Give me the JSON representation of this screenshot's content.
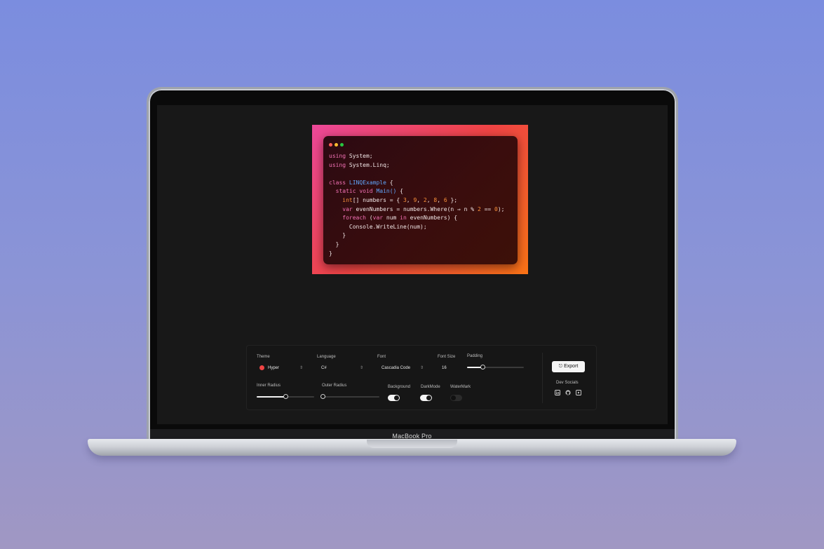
{
  "device": {
    "label": "MacBook Pro"
  },
  "code_window": {
    "lines": [
      [
        {
          "t": "using",
          "c": "kw"
        },
        {
          "t": " System;",
          "c": ""
        }
      ],
      [
        {
          "t": "using",
          "c": "kw"
        },
        {
          "t": " System.Linq;",
          "c": ""
        }
      ],
      [],
      [
        {
          "t": "class",
          "c": "kw"
        },
        {
          "t": " ",
          "c": ""
        },
        {
          "t": "LINQExample",
          "c": "ty"
        },
        {
          "t": " {",
          "c": ""
        }
      ],
      [
        {
          "t": "  ",
          "c": ""
        },
        {
          "t": "static void",
          "c": "kw"
        },
        {
          "t": " ",
          "c": ""
        },
        {
          "t": "Main()",
          "c": "ty"
        },
        {
          "t": " {",
          "c": ""
        }
      ],
      [
        {
          "t": "    ",
          "c": ""
        },
        {
          "t": "int",
          "c": "num"
        },
        {
          "t": "[] numbers = { ",
          "c": ""
        },
        {
          "t": "3",
          "c": "num"
        },
        {
          "t": ", ",
          "c": ""
        },
        {
          "t": "9",
          "c": "num"
        },
        {
          "t": ", ",
          "c": ""
        },
        {
          "t": "2",
          "c": "num"
        },
        {
          "t": ", ",
          "c": ""
        },
        {
          "t": "8",
          "c": "num"
        },
        {
          "t": ", ",
          "c": ""
        },
        {
          "t": "6",
          "c": "num"
        },
        {
          "t": " };",
          "c": ""
        }
      ],
      [
        {
          "t": "    ",
          "c": ""
        },
        {
          "t": "var",
          "c": "kw"
        },
        {
          "t": " evenNumbers = numbers.Where(n ⇒ n % ",
          "c": ""
        },
        {
          "t": "2",
          "c": "num"
        },
        {
          "t": " == ",
          "c": ""
        },
        {
          "t": "0",
          "c": "num"
        },
        {
          "t": ");",
          "c": ""
        }
      ],
      [
        {
          "t": "    ",
          "c": ""
        },
        {
          "t": "foreach",
          "c": "kw"
        },
        {
          "t": " (",
          "c": ""
        },
        {
          "t": "var",
          "c": "kw"
        },
        {
          "t": " num ",
          "c": ""
        },
        {
          "t": "in",
          "c": "kw"
        },
        {
          "t": " evenNumbers) {",
          "c": ""
        }
      ],
      [
        {
          "t": "      Console.WriteLine(num);",
          "c": ""
        }
      ],
      [
        {
          "t": "    }",
          "c": ""
        }
      ],
      [
        {
          "t": "  }",
          "c": ""
        }
      ],
      [
        {
          "t": "}",
          "c": ""
        }
      ]
    ]
  },
  "controls": {
    "theme": {
      "label": "Theme",
      "value": "Hyper"
    },
    "language": {
      "label": "Language",
      "value": "C#"
    },
    "font": {
      "label": "Font",
      "value": "Cascadia Code"
    },
    "font_size": {
      "label": "Font Size",
      "value": "16"
    },
    "padding": {
      "label": "Padding",
      "level": 0.27
    },
    "inner_radius": {
      "label": "Inner Radius",
      "level": 0.5
    },
    "outer_radius": {
      "label": "Outer Radius",
      "level": 0.0
    },
    "background": {
      "label": "Background",
      "on": true
    },
    "darkmode": {
      "label": "DarkMode",
      "on": true
    },
    "watermark": {
      "label": "WaterMark",
      "on": false
    },
    "export_label": "Export",
    "dev_socials_label": "Dev Socials",
    "socials": [
      "linkedin-icon",
      "github-icon",
      "youtube-icon"
    ]
  },
  "colors": {
    "frame_gradient": [
      "#ec4899",
      "#ef4444",
      "#f97316"
    ],
    "theme_dot": "#ef4444"
  }
}
